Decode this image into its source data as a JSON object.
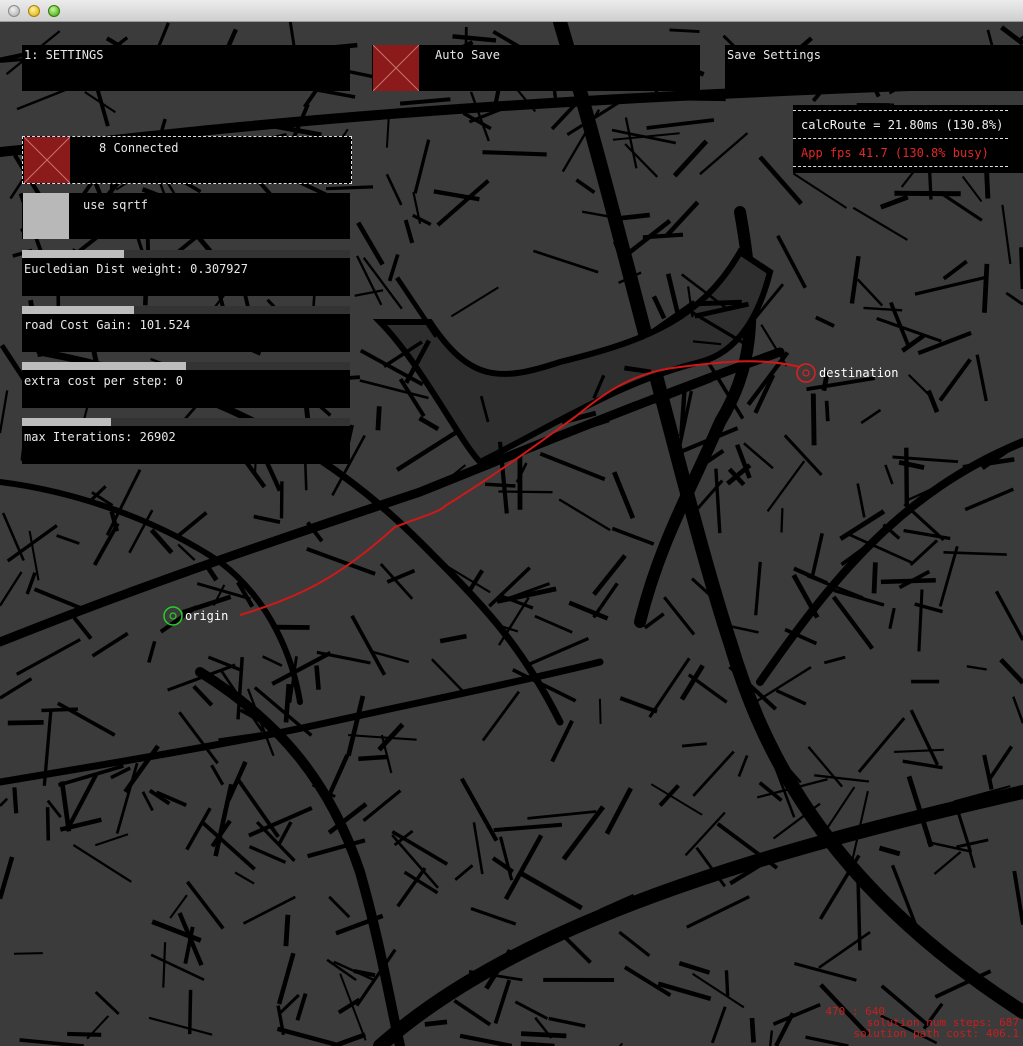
{
  "gui": {
    "settings_title": "1: SETTINGS",
    "auto_save_label": "Auto Save",
    "save_settings_label": "Save Settings",
    "connected_label": "8 Connected",
    "use_sqrtf_label": "use sqrtf",
    "sliders": [
      {
        "label": "Eucledian Dist weight: 0.307927",
        "fraction": 0.31
      },
      {
        "label": "road Cost Gain: 101.524",
        "fraction": 0.34
      },
      {
        "label": "extra cost per step: 0",
        "fraction": 0.5
      },
      {
        "label": "max Iterations: 26902",
        "fraction": 0.27
      }
    ]
  },
  "perf": {
    "calc_route": "calcRoute = 21.80ms (130.8%)",
    "app_fps": "App fps 41.7 (130.8% busy)"
  },
  "markers": {
    "origin_label": "origin",
    "destination_label": "destination"
  },
  "status": {
    "line1": "470 : 640",
    "line2": "solution num steps: 687",
    "line3": "solution path cost: 406.1"
  },
  "colors": {
    "background": "#3b3b3b",
    "roads": "#000000",
    "route": "#d01818",
    "origin": "#27d027",
    "destination": "#e02020",
    "toggle_on": "#8b1a1a",
    "toggle_off": "#b8b8b8"
  }
}
